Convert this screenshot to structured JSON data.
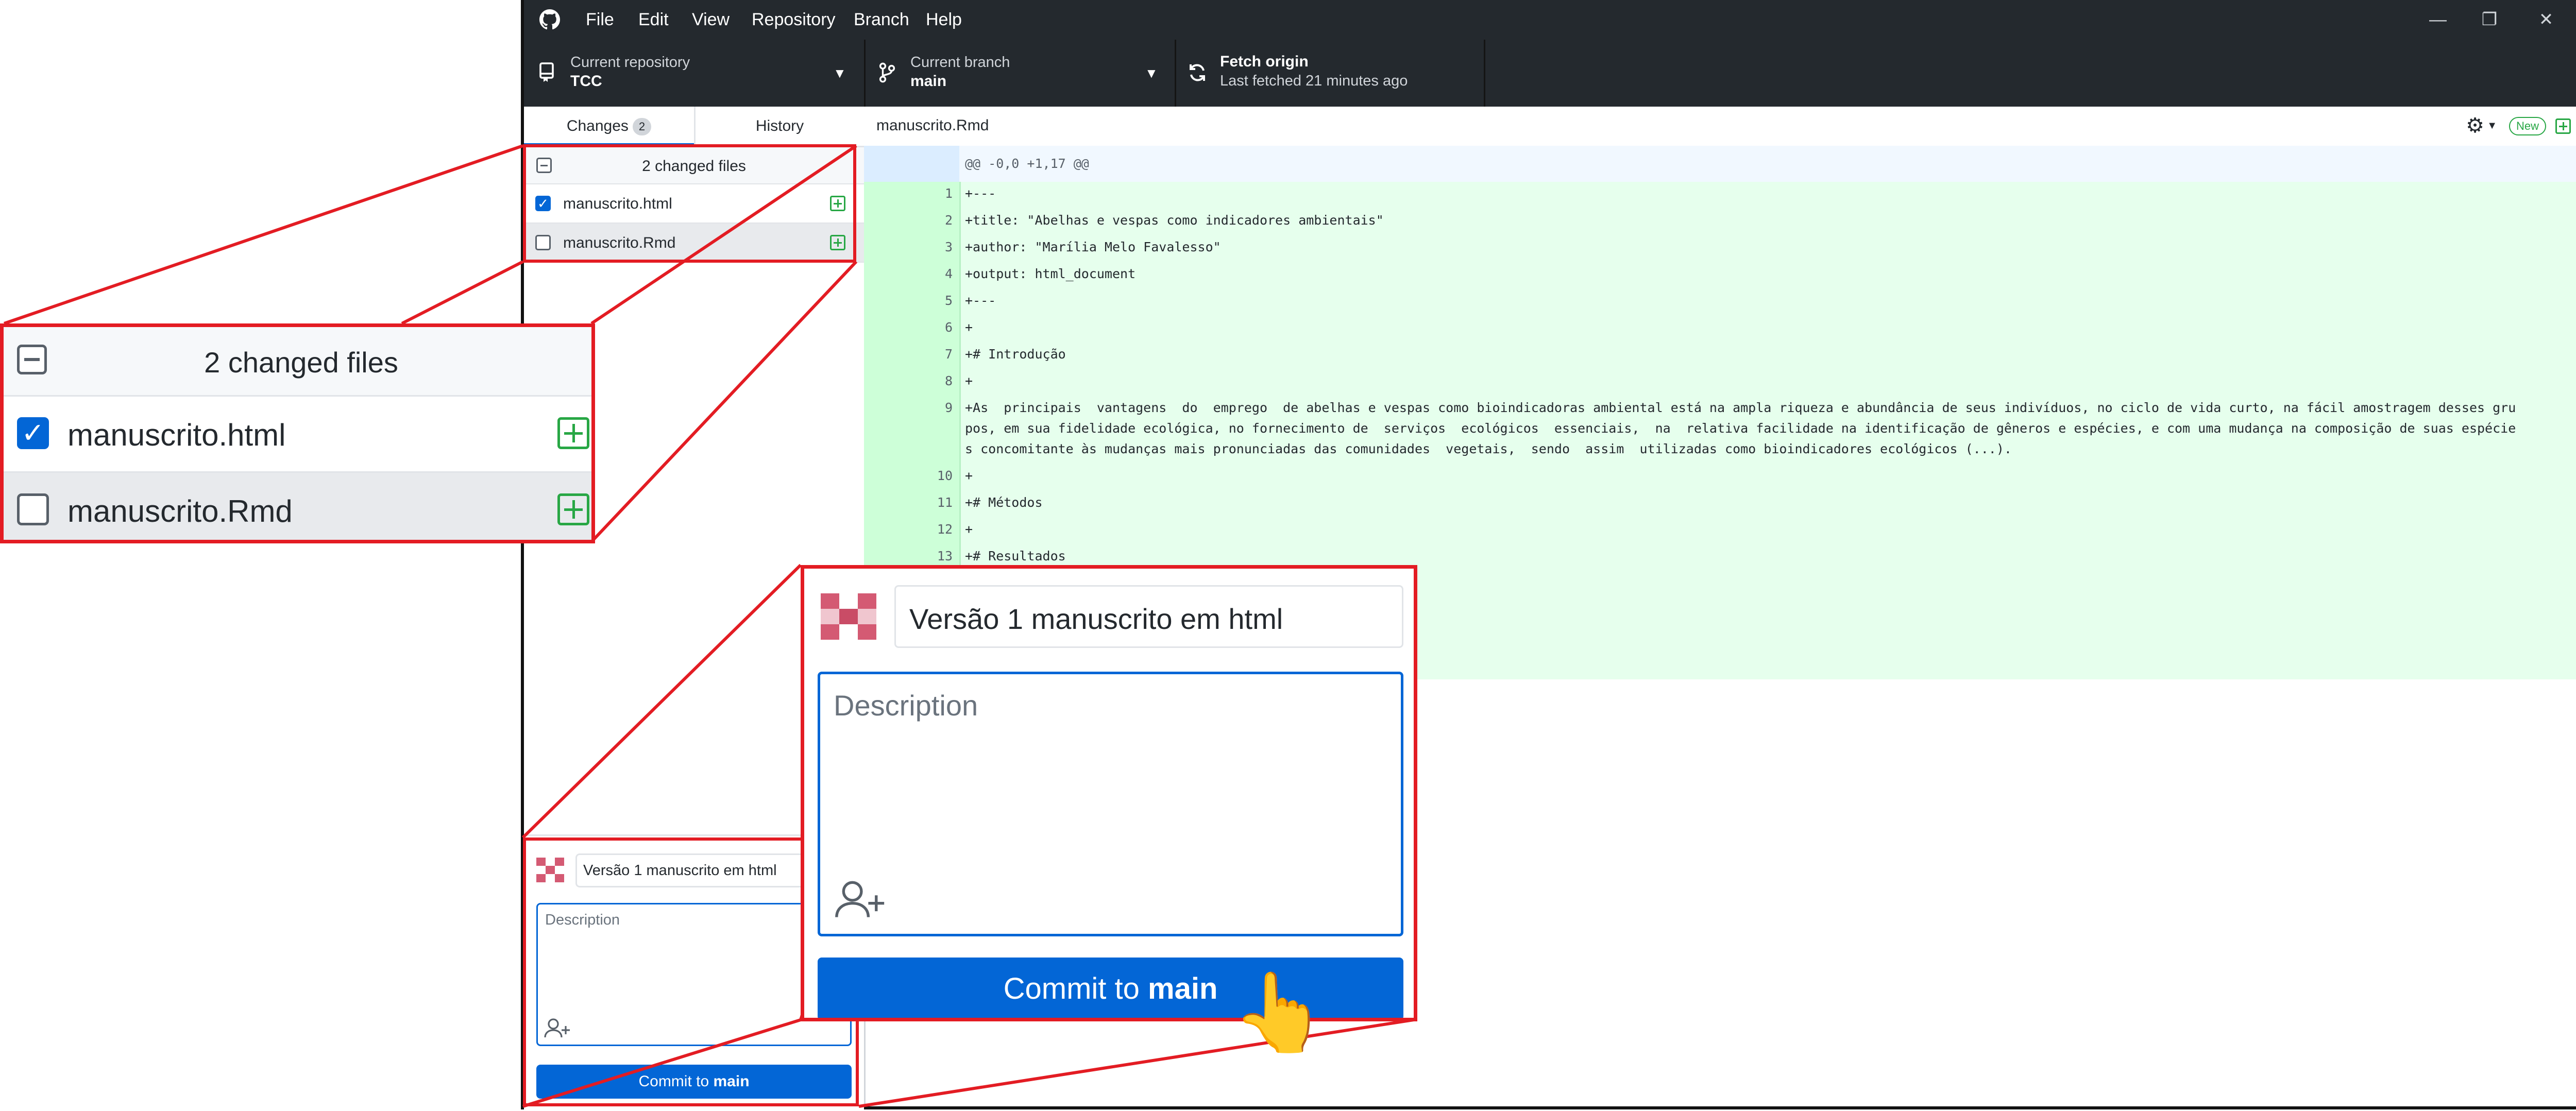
{
  "window": {
    "menu": [
      "File",
      "Edit",
      "View",
      "Repository",
      "Branch",
      "Help"
    ],
    "controls": {
      "minimize": "—",
      "restore": "❐",
      "close": "✕"
    }
  },
  "toolbar": {
    "repo": {
      "label": "Current repository",
      "value": "TCC",
      "icon": "repo-icon"
    },
    "branch": {
      "label": "Current branch",
      "value": "main",
      "icon": "branch-icon"
    },
    "fetch": {
      "label": "Fetch origin",
      "sub": "Last fetched 21 minutes ago",
      "icon": "sync-icon"
    }
  },
  "tabs": {
    "changes": "Changes",
    "changes_count": "2",
    "history": "History"
  },
  "files": {
    "header": "2 changed files",
    "items": [
      {
        "name": "manuscrito.html",
        "checked": true
      },
      {
        "name": "manuscrito.Rmd",
        "checked": false
      }
    ]
  },
  "diff": {
    "filename": "manuscrito.Rmd",
    "new_badge": "New",
    "hunk": "@@ -0,0 +1,17 @@",
    "lines": [
      {
        "n": "1",
        "t": "+---"
      },
      {
        "n": "2",
        "t": "+title: \"Abelhas e vespas como indicadores ambientais\""
      },
      {
        "n": "3",
        "t": "+author: \"Marília Melo Favalesso\""
      },
      {
        "n": "4",
        "t": "+output: html_document"
      },
      {
        "n": "5",
        "t": "+---"
      },
      {
        "n": "6",
        "t": "+"
      },
      {
        "n": "7",
        "t": "+# Introdução"
      },
      {
        "n": "8",
        "t": "+"
      },
      {
        "n": "9",
        "t": "+As  principais  vantagens  do  emprego  de abelhas e vespas como bioindicadoras ambiental está na ampla riqueza e abundância de seus indivíduos, no ciclo de vida curto, na fácil amostragem desses gru"
      },
      {
        "n": "",
        "t": "pos, em sua fidelidade ecológica, no fornecimento de  serviços  ecológicos  essenciais,  na  relativa facilidade na identificação de gêneros e espécies, e com uma mudança na composição de suas espécie"
      },
      {
        "n": "",
        "t": "s concomitante às mudanças mais pronunciadas das comunidades  vegetais,  sendo  assim  utilizadas como bioindicadores ecológicos (...)."
      },
      {
        "n": "10",
        "t": "+"
      },
      {
        "n": "11",
        "t": "+# Métodos"
      },
      {
        "n": "12",
        "t": "+"
      },
      {
        "n": "13",
        "t": "+# Resultados"
      }
    ]
  },
  "commit": {
    "summary": "Versão 1 manuscrito em html",
    "description_placeholder": "Description",
    "button_prefix": "Commit to ",
    "button_branch": "main",
    "coauthor_icon": "add-coauthor-icon"
  },
  "colors": {
    "titlebar": "#24292e",
    "accent": "#0366d6",
    "added_bg": "#e6ffed",
    "highlight": "#e31c23"
  }
}
